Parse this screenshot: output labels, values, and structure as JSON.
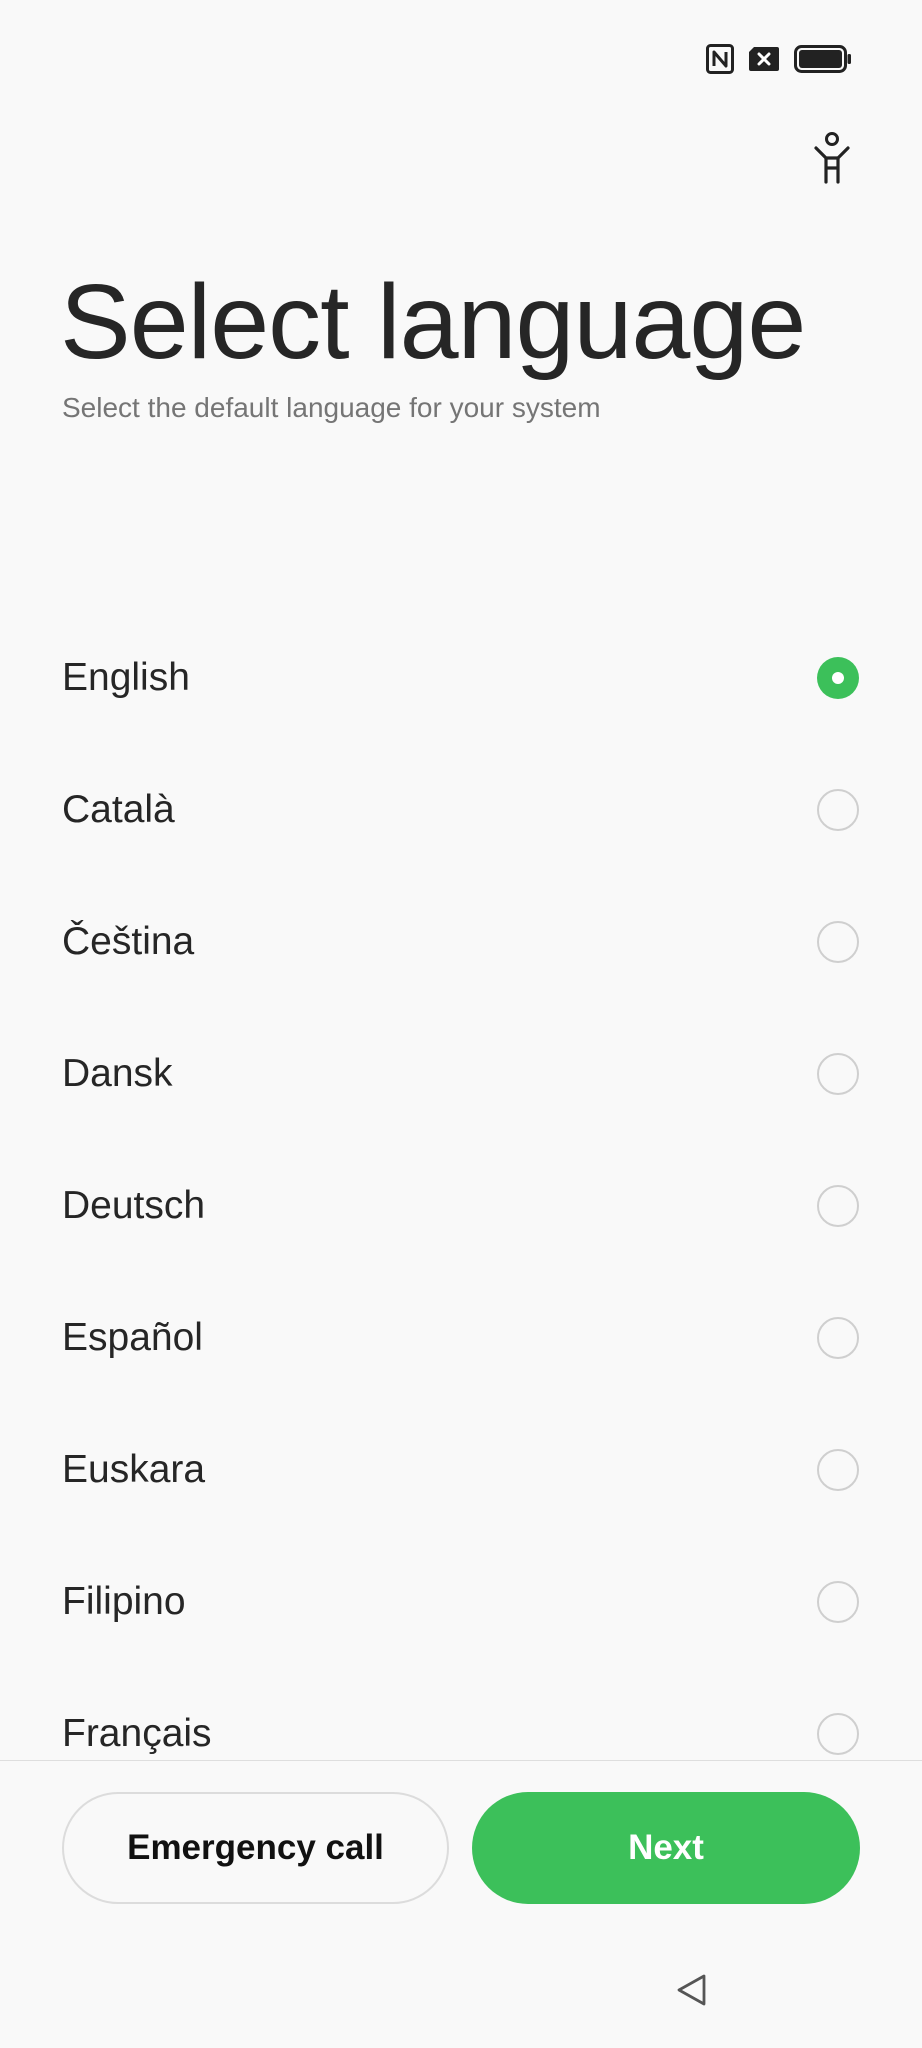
{
  "status_bar": {
    "icons": [
      "nfc-icon",
      "no-sim-icon",
      "battery-full-icon"
    ]
  },
  "accessibility": {
    "icon": "accessibility-icon"
  },
  "header": {
    "title": "Select language",
    "subtitle": "Select the default language for your system"
  },
  "languages": [
    {
      "label": "English",
      "selected": true
    },
    {
      "label": "Català",
      "selected": false
    },
    {
      "label": "Čeština",
      "selected": false
    },
    {
      "label": "Dansk",
      "selected": false
    },
    {
      "label": "Deutsch",
      "selected": false
    },
    {
      "label": "Español",
      "selected": false
    },
    {
      "label": "Euskara",
      "selected": false
    },
    {
      "label": "Filipino",
      "selected": false
    },
    {
      "label": "Français",
      "selected": false
    }
  ],
  "buttons": {
    "emergency_label": "Emergency call",
    "next_label": "Next"
  },
  "nav": {
    "back_icon": "back-triangle-icon"
  },
  "colors": {
    "accent": "#3cc05a",
    "background": "#f9f9f9",
    "text": "#262626",
    "subtext": "#757575",
    "radio_border": "#cfcfcf"
  }
}
